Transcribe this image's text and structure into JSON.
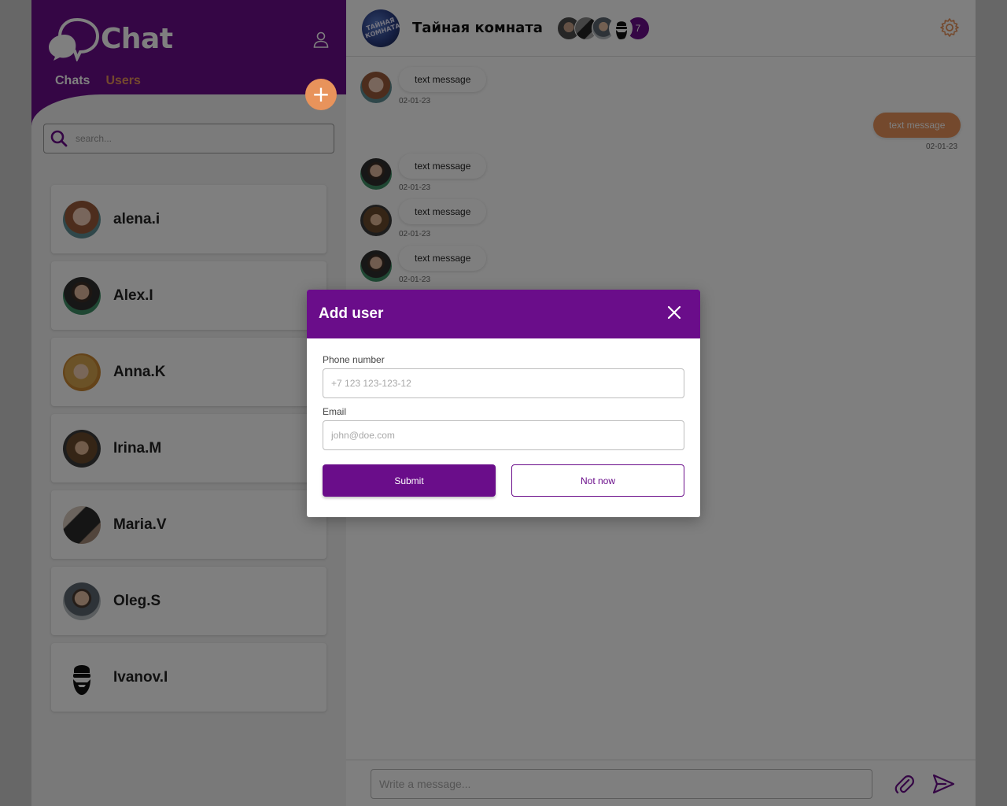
{
  "colors": {
    "brand_purple": "#6a0d8a",
    "accent_orange": "#e8935b",
    "sidebar_bg": "#f2f2f2"
  },
  "sidebar": {
    "logo_text": "Chat",
    "tabs": [
      {
        "label": "Chats",
        "active": false
      },
      {
        "label": "Users",
        "active": true
      }
    ],
    "add_button_icon": "plus-icon",
    "search_placeholder": "search...",
    "users": [
      {
        "name": "alena.i"
      },
      {
        "name": "Alex.I"
      },
      {
        "name": "Anna.K"
      },
      {
        "name": "Irina.M"
      },
      {
        "name": "Maria.V"
      },
      {
        "name": "Oleg.S"
      },
      {
        "name": "Ivanov.I"
      }
    ]
  },
  "chat": {
    "room_title": "Тайная комната",
    "room_avatar_text": "ТАЙНАЯ КОМНАТА",
    "member_count": "7",
    "messages": [
      {
        "text": "text message",
        "date": "02-01-23",
        "direction": "in"
      },
      {
        "text": "text message",
        "date": "02-01-23",
        "direction": "out"
      },
      {
        "text": "text message",
        "date": "02-01-23",
        "direction": "in"
      },
      {
        "text": "text message",
        "date": "02-01-23",
        "direction": "in"
      },
      {
        "text": "text message",
        "date": "02-01-23",
        "direction": "in"
      }
    ],
    "composer_placeholder": "Write a message..."
  },
  "modal": {
    "title": "Add user",
    "phone_label": "Phone number",
    "phone_placeholder": "+7 123 123-123-12",
    "email_label": "Email",
    "email_placeholder": "john@doe.com",
    "submit_label": "Submit",
    "cancel_label": "Not now"
  }
}
